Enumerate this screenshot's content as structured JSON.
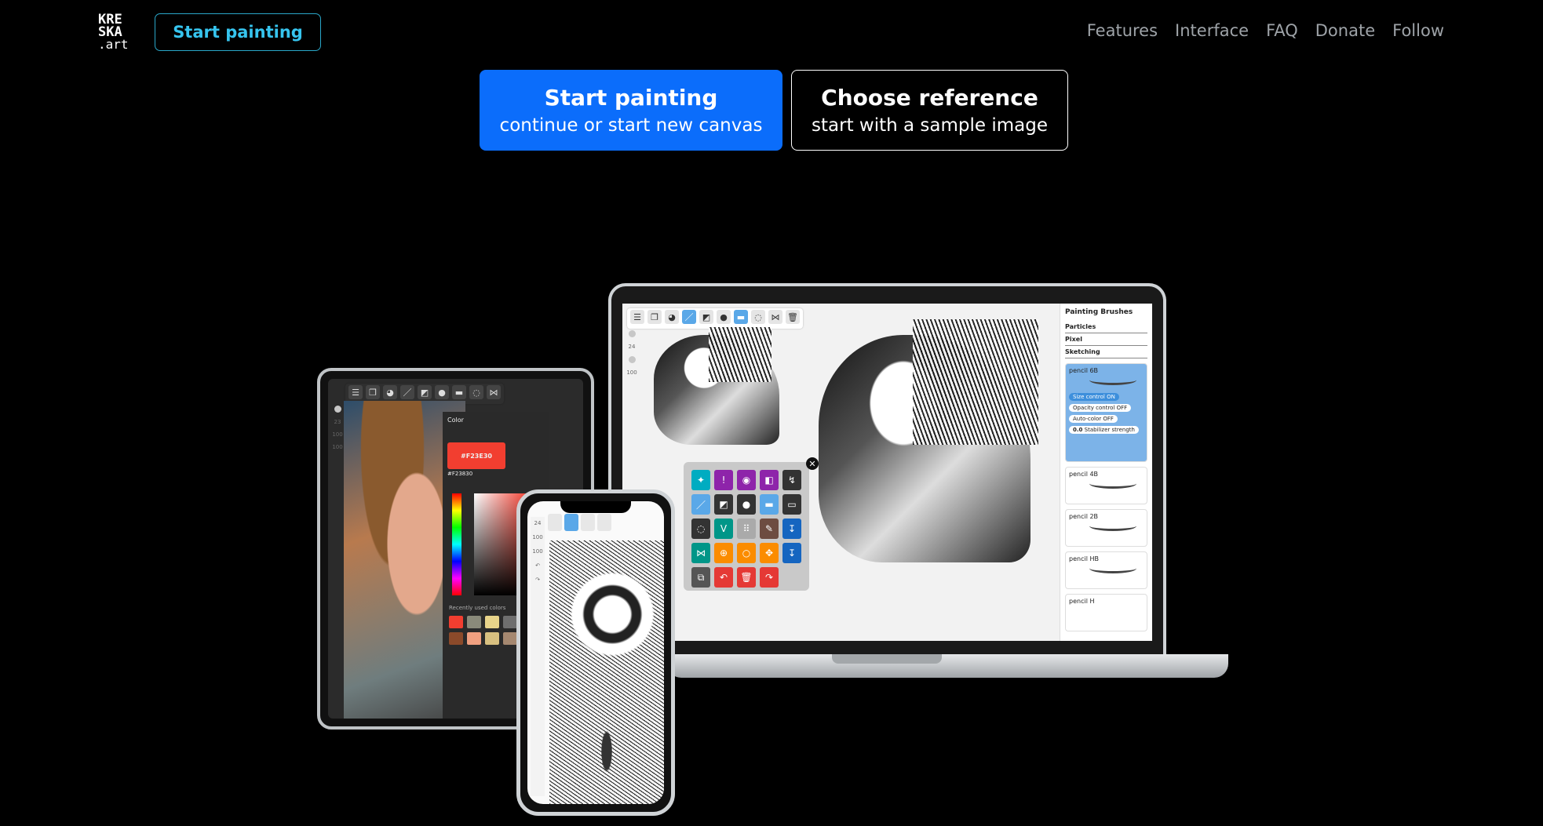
{
  "header": {
    "logo_line1": "KRE",
    "logo_line2": "SKA",
    "logo_line3": ".art",
    "start_button": "Start painting",
    "nav": [
      "Features",
      "Interface",
      "FAQ",
      "Donate",
      "Follow"
    ]
  },
  "hero": {
    "primary_title": "Start painting",
    "primary_subtitle": "continue or start new canvas",
    "secondary_title": "Choose reference",
    "secondary_subtitle": "start with a sample image"
  },
  "laptop": {
    "panel_title": "Painting Brushes",
    "categories": [
      "Particles",
      "Pixel",
      "Sketching"
    ],
    "selected_brush": "pencil 6B",
    "toggles": [
      "Size control ON",
      "Opacity control OFF",
      "Auto-color OFF"
    ],
    "stabilizer_value": "0.0",
    "stabilizer_label": "Stabilizer strength",
    "brushes": [
      "pencil 4B",
      "pencil 2B",
      "pencil HB",
      "pencil H"
    ],
    "rail_values": [
      "24",
      "100"
    ]
  },
  "tablet": {
    "panel_title": "Color",
    "hex_primary": "#F23E30",
    "hex_secondary": "#F23830",
    "recent_label": "Recently used colors",
    "rail_values": [
      "23",
      "100",
      "100"
    ]
  },
  "phone": {
    "rail_values": [
      "24",
      "100",
      "100"
    ]
  },
  "colors": {
    "accent_blue": "#0b6dfb",
    "accent_cyan": "#36c4ee",
    "swatch_red": "#f23e30"
  }
}
